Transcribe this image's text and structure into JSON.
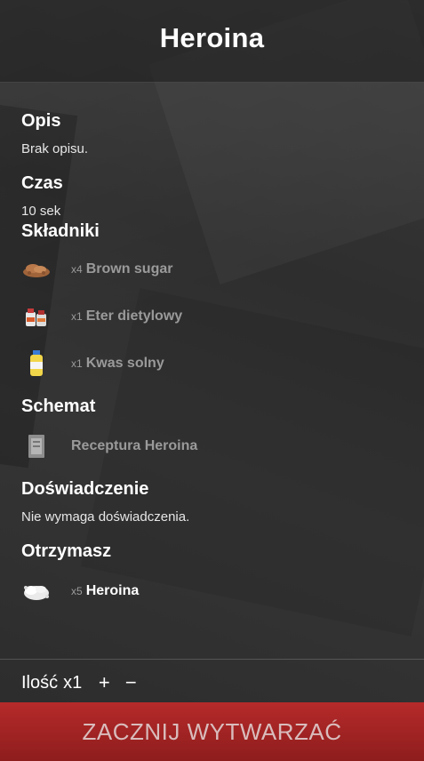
{
  "header": {
    "title": "Heroina"
  },
  "sections": {
    "description": {
      "title": "Opis",
      "text": "Brak opisu."
    },
    "time": {
      "title": "Czas",
      "text": "10 sek"
    },
    "ingredients": {
      "title": "Składniki",
      "items": [
        {
          "qty": "x4",
          "name": "Brown sugar",
          "icon": "brown-sugar-icon"
        },
        {
          "qty": "x1",
          "name": "Eter dietylowy",
          "icon": "ether-bottle-icon"
        },
        {
          "qty": "x1",
          "name": "Kwas solny",
          "icon": "acid-bottle-icon"
        }
      ]
    },
    "schema": {
      "title": "Schemat",
      "item": {
        "name": "Receptura Heroina",
        "icon": "recipe-card-icon"
      }
    },
    "experience": {
      "title": "Doświadczenie",
      "text": "Nie wymaga doświadczenia."
    },
    "result": {
      "title": "Otrzymasz",
      "item": {
        "qty": "x5",
        "name": "Heroina",
        "icon": "heroin-powder-icon"
      }
    }
  },
  "quantity": {
    "label": "Ilość",
    "value": "x1",
    "plus": "+",
    "minus": "−"
  },
  "start_button": {
    "label": "ZACZNIJ WYTWARZAĆ"
  },
  "colors": {
    "accent": "#a52424",
    "muted": "#9a9a9a"
  }
}
